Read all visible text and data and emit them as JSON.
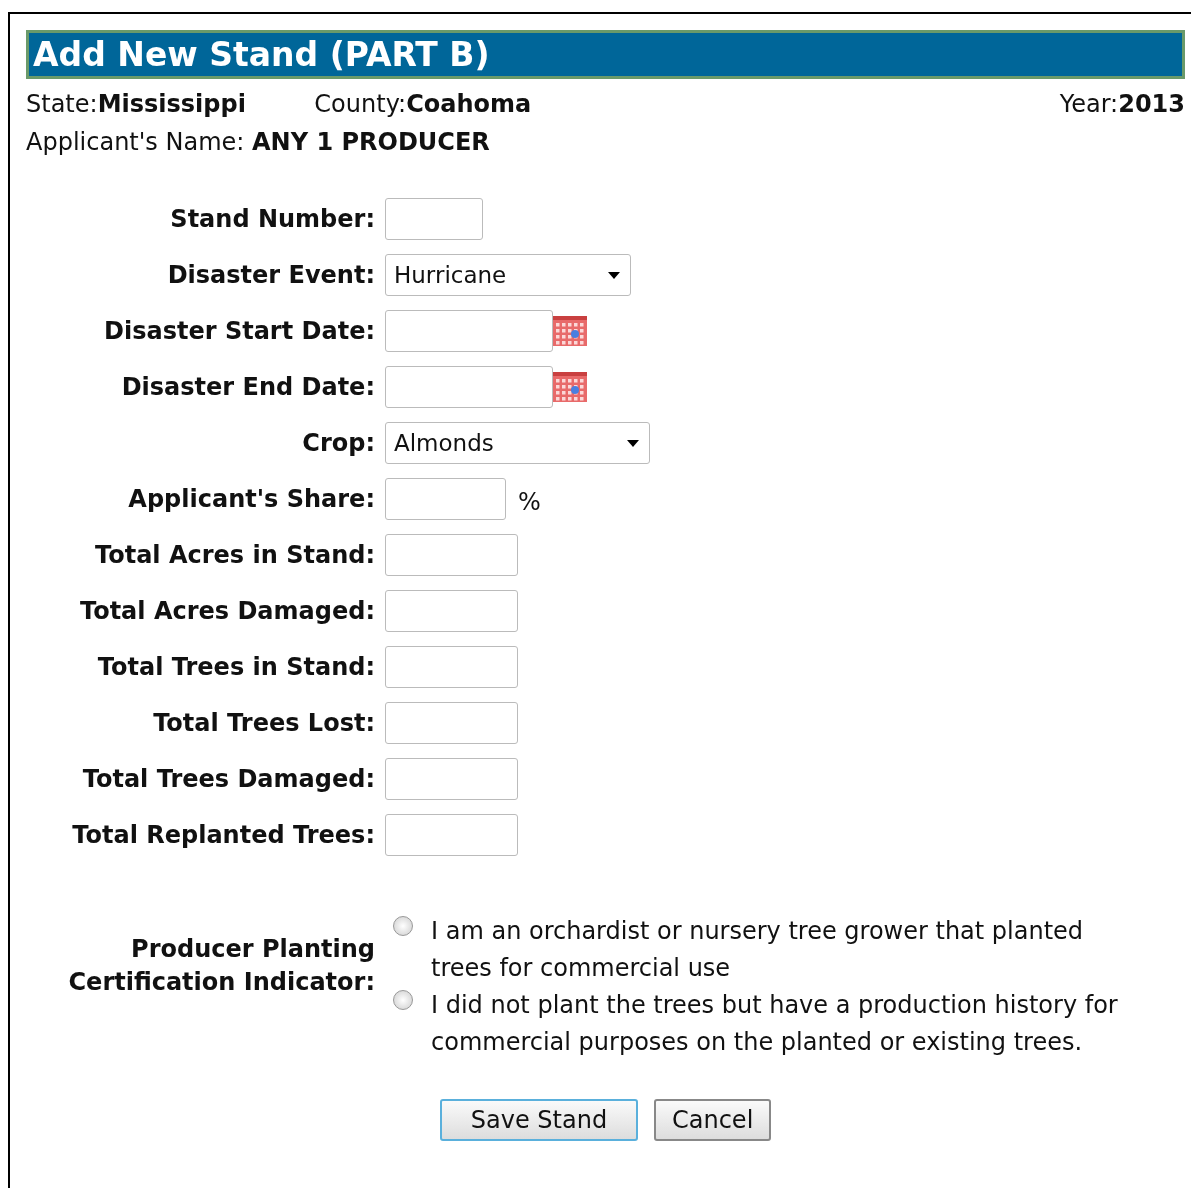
{
  "title": "Add New Stand (PART B)",
  "info": {
    "state_label": "State:",
    "state": "Mississippi",
    "county_label": "County:",
    "county": "Coahoma",
    "year_label": "Year:",
    "year": "2013",
    "applicant_label": "Applicant's Name:",
    "applicant": "ANY 1 PRODUCER"
  },
  "fields": [
    {
      "label": "Stand Number:",
      "kind": "short"
    },
    {
      "label": "Disaster Event:",
      "kind": "select",
      "value": "Hurricane"
    },
    {
      "label": "Disaster Start Date:",
      "kind": "date"
    },
    {
      "label": "Disaster End Date:",
      "kind": "date"
    },
    {
      "label": "Crop:",
      "kind": "select",
      "value": "Almonds"
    },
    {
      "label": "Applicant's Share:",
      "kind": "percent",
      "suffix": "%"
    },
    {
      "label": "Total Acres in Stand:",
      "kind": "text"
    },
    {
      "label": "Total Acres Damaged:",
      "kind": "text"
    },
    {
      "label": "Total Trees in Stand:",
      "kind": "text"
    },
    {
      "label": "Total Trees Lost:",
      "kind": "text"
    },
    {
      "label": "Total Trees Damaged:",
      "kind": "text"
    },
    {
      "label": "Total Replanted Trees:",
      "kind": "text"
    }
  ],
  "certification": {
    "label": "Producer Planting Certification Indicator:",
    "options": [
      {
        "text": "I am an orchardist or nursery tree grower that planted trees for commercial use",
        "selected": false
      },
      {
        "text": "I did not plant the trees but have a production history for commercial purposes on the planted or existing trees.",
        "selected": false
      }
    ]
  },
  "buttons": [
    {
      "label": "Save Stand",
      "kind": "primary"
    },
    {
      "label": "Cancel",
      "kind": "secondary"
    }
  ]
}
